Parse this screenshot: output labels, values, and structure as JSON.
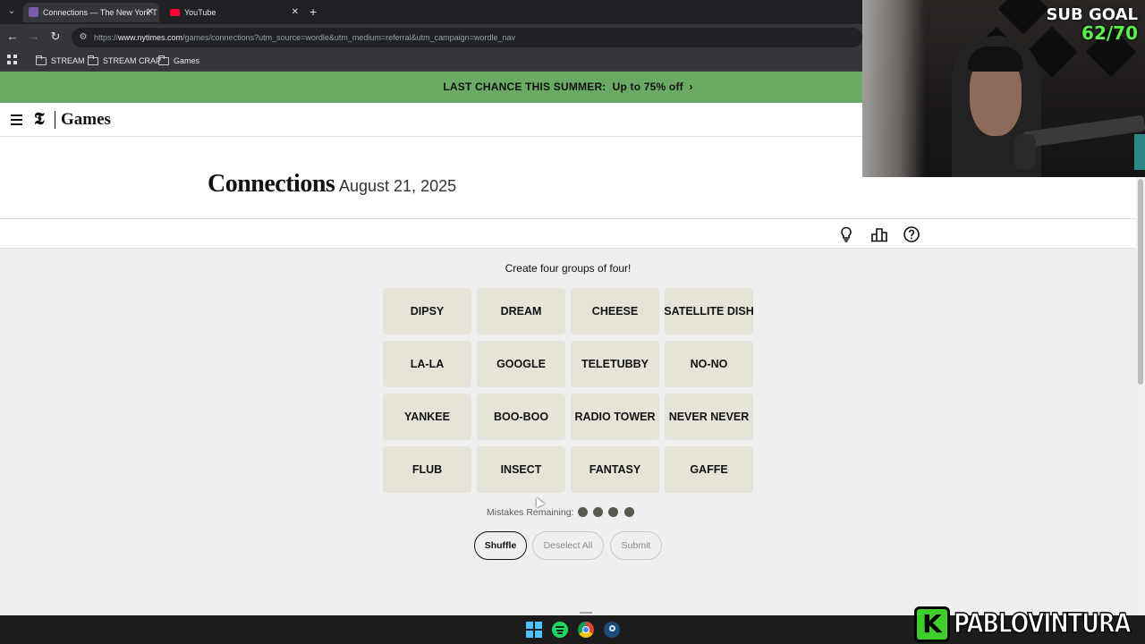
{
  "browser": {
    "tabs": [
      {
        "title": "Connections — The New York T",
        "favicon": "nyt-games-icon",
        "active": true
      },
      {
        "title": "YouTube",
        "favicon": "youtube-icon",
        "active": false
      }
    ],
    "url": {
      "prefix": "https://",
      "host": "www.nytimes.com",
      "path": "/games/connections?utm_source=wordle&utm_medium=referral&utm_campaign=wordle_nav"
    },
    "bookmarks": [
      "STREAM",
      "STREAM CRAP",
      "Games"
    ]
  },
  "promo": {
    "text": "LAST CHANCE THIS SUMMER:",
    "offer": "Up to 75% off",
    "chevron": "›",
    "color": "#6aaa64"
  },
  "header": {
    "logo": "𝕿",
    "brand": "Games"
  },
  "game": {
    "title": "Connections",
    "date": "August 21, 2025",
    "instructions": "Create four groups of four!",
    "tiles": [
      [
        "DIPSY",
        "DREAM",
        "CHEESE",
        "SATELLITE DISH"
      ],
      [
        "LA-LA",
        "GOOGLE",
        "TELETUBBY",
        "NO-NO"
      ],
      [
        "YANKEE",
        "BOO-BOO",
        "RADIO TOWER",
        "NEVER NEVER"
      ],
      [
        "FLUB",
        "INSECT",
        "FANTASY",
        "GAFFE"
      ]
    ],
    "tile_color": "#e6e4d9",
    "mistakes_label": "Mistakes Remaining:",
    "mistakes_remaining": 4,
    "buttons": {
      "shuffle": "Shuffle",
      "deselect": "Deselect All",
      "submit": "Submit"
    }
  },
  "toolbar_icons": [
    "lightbulb-icon",
    "leaderboard-icon",
    "help-icon"
  ],
  "taskbar": [
    "windows-start-icon",
    "spotify-icon",
    "chrome-icon",
    "steam-icon"
  ],
  "overlay": {
    "sub_goal_label": "SUB GOAL",
    "sub_goal_count": "62/70",
    "brand_letter": "K",
    "brand_name": "PABLOVINTURA"
  }
}
